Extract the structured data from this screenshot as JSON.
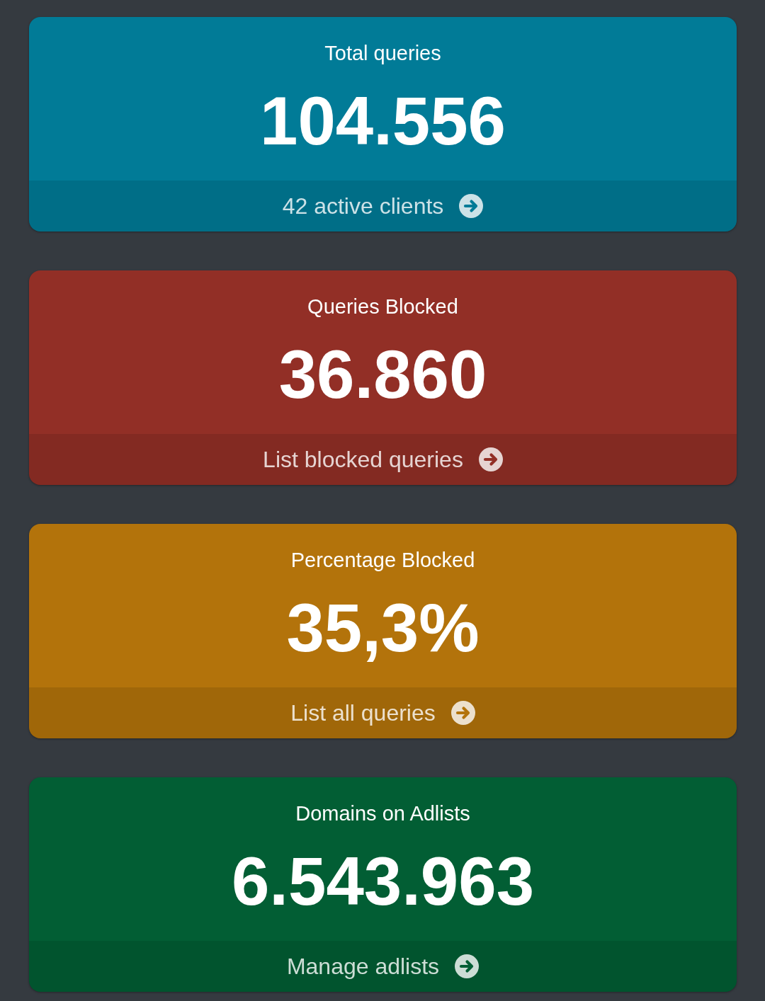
{
  "cards": [
    {
      "title": "Total queries",
      "value": "104.556",
      "link": "42 active clients",
      "color": "#017b97"
    },
    {
      "title": "Queries Blocked",
      "value": "36.860",
      "link": "List blocked queries",
      "color": "#922f26"
    },
    {
      "title": "Percentage Blocked",
      "value": "35,3%",
      "link": "List all queries",
      "color": "#b3730b"
    },
    {
      "title": "Domains on Adlists",
      "value": "6.543.963",
      "link": "Manage adlists",
      "color": "#025e34"
    }
  ]
}
